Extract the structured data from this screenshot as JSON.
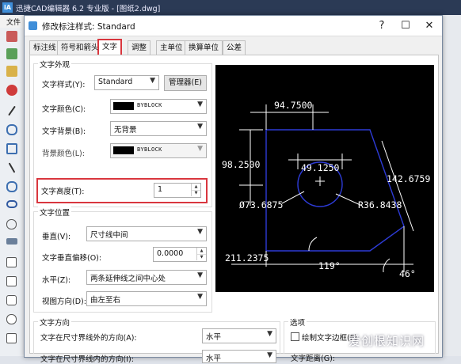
{
  "app": {
    "title": "迅捷CAD编辑器 6.2 专业版 - [图纸2.dwg]",
    "logo": "iA",
    "menu_first": "文件"
  },
  "dialog": {
    "title": "修改标注样式: Standard",
    "minimize": "?",
    "maximize": "☐",
    "close": "✕"
  },
  "tabs": [
    "标注线",
    "符号和箭头",
    "文字",
    "调整",
    "主单位",
    "换算单位",
    "公差"
  ],
  "text_appearance": {
    "group_title": "文字外观",
    "style_label": "文字样式(Y):",
    "style_value": "Standard",
    "manager_button": "管理器(E)",
    "color_label": "文字颜色(C):",
    "color_value": "BYBLOCK",
    "background_label": "文字背景(B):",
    "background_value": "无背景",
    "bg_color_label": "背景颜色(L):",
    "bg_color_value": "BYBLOCK",
    "height_label": "文字高度(T):",
    "height_value": "1"
  },
  "text_position": {
    "group_title": "文字位置",
    "vertical_label": "垂直(V):",
    "vertical_value": "尺寸线中间",
    "vertical_offset_label": "文字垂直偏移(O):",
    "vertical_offset_value": "0.0000",
    "horizontal_label": "水平(Z):",
    "horizontal_value": "两条延伸线之间中心处",
    "view_direction_label": "视图方向(D):",
    "view_direction_value": "由左至右"
  },
  "text_direction": {
    "group_title": "文字方向",
    "outside_label": "文字在尺寸界线外的方向(A):",
    "outside_value": "水平",
    "inside_label": "文字在尺寸界线内的方向(I):",
    "inside_value": "水平"
  },
  "options": {
    "group_title": "选项",
    "frame_checkbox_label": "绘制文字边框(F)",
    "frame_checked": false,
    "distance_label": "文字距离(G):"
  },
  "preview": {
    "dim_top": "94.7500",
    "dim_left": "98.2500",
    "dim_circle": "49.1250",
    "dim_diameter": "Ø73.6875",
    "dim_radius": "R36.8438",
    "dim_slant": "142.6759",
    "dim_bottom": "211.2375",
    "angle_1": "119°",
    "angle_2": "46°"
  },
  "watermark": "爱创根知识网"
}
